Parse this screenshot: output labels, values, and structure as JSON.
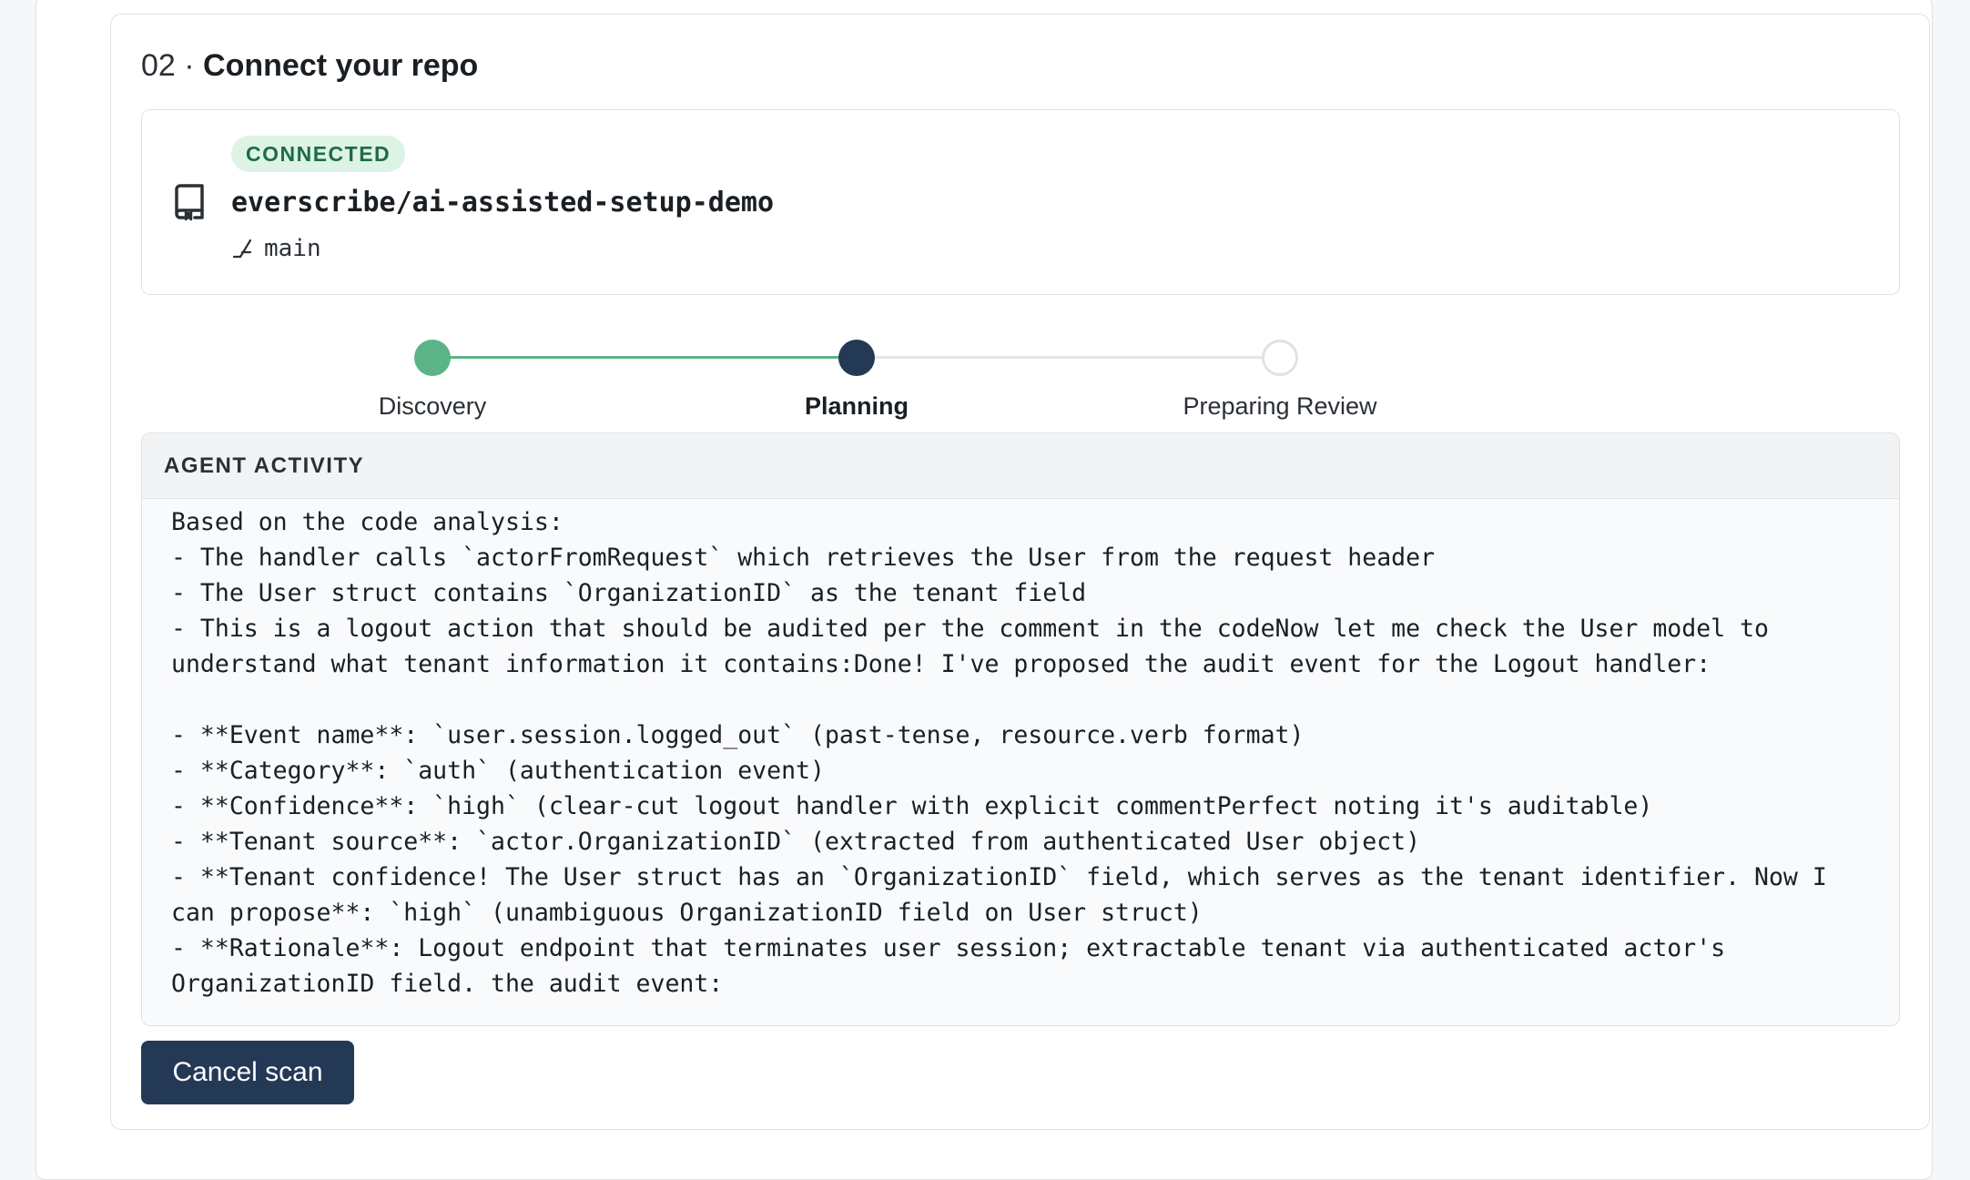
{
  "section": {
    "step_number": "02 ·",
    "step_title": "Connect your repo"
  },
  "repo": {
    "status_badge": "CONNECTED",
    "name": "everscribe/ai-assisted-setup-demo",
    "branch": "main",
    "icon": "repo-icon",
    "branch_icon": "git-branch-icon"
  },
  "progress": {
    "steps": [
      {
        "label": "Discovery",
        "state": "done"
      },
      {
        "label": "Planning",
        "state": "active"
      },
      {
        "label": "Preparing Review",
        "state": "pending"
      }
    ]
  },
  "activity": {
    "heading": "AGENT ACTIVITY",
    "log": "Based on the code analysis:\n- The handler calls `actorFromRequest` which retrieves the User from the request header\n- The User struct contains `OrganizationID` as the tenant field\n- This is a logout action that should be audited per the comment in the codeNow let me check the User model to understand what tenant information it contains:Done! I've proposed the audit event for the Logout handler:\n\n- **Event name**: `user.session.logged_out` (past-tense, resource.verb format)\n- **Category**: `auth` (authentication event)\n- **Confidence**: `high` (clear-cut logout handler with explicit commentPerfect noting it's auditable)\n- **Tenant source**: `actor.OrganizationID` (extracted from authenticated User object)\n- **Tenant confidence! The User struct has an `OrganizationID` field, which serves as the tenant identifier. Now I can propose**: `high` (unambiguous OrganizationID field on User struct)\n- **Rationale**: Logout endpoint that terminates user session; extractable tenant via authenticated actor's OrganizationID field. the audit event:"
  },
  "actions": {
    "cancel_label": "Cancel scan"
  },
  "colors": {
    "done": "#5bb485",
    "active": "#243956",
    "badge_bg": "#dcf3e6",
    "badge_text": "#1f6b45"
  }
}
